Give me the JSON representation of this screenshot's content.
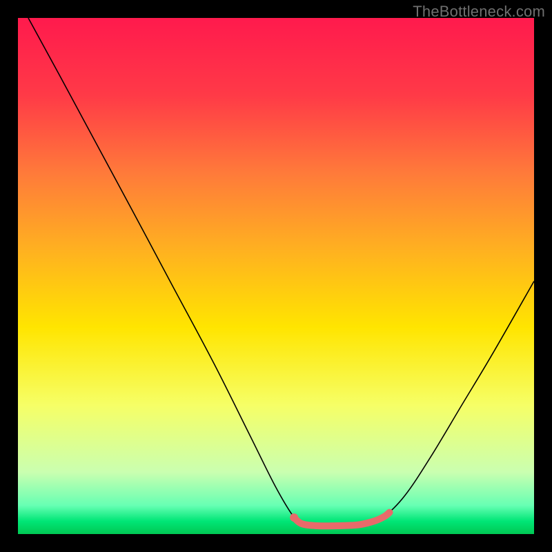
{
  "watermark": "TheBottleneck.com",
  "chart_data": {
    "type": "line",
    "title": "",
    "xlabel": "",
    "ylabel": "",
    "xlim": [
      0,
      100
    ],
    "ylim": [
      0,
      100
    ],
    "grid": false,
    "legend": false,
    "background_gradient": {
      "stops": [
        {
          "offset": 0.0,
          "color": "#ff1a4d"
        },
        {
          "offset": 0.15,
          "color": "#ff3a47"
        },
        {
          "offset": 0.3,
          "color": "#ff7a3a"
        },
        {
          "offset": 0.45,
          "color": "#ffb120"
        },
        {
          "offset": 0.6,
          "color": "#ffe500"
        },
        {
          "offset": 0.75,
          "color": "#f6ff66"
        },
        {
          "offset": 0.88,
          "color": "#caffb0"
        },
        {
          "offset": 0.945,
          "color": "#66ffb3"
        },
        {
          "offset": 0.975,
          "color": "#00e676"
        },
        {
          "offset": 1.0,
          "color": "#00c853"
        }
      ]
    },
    "series": [
      {
        "name": "bottleneck-curve",
        "color": "#000000",
        "width": 1.6,
        "points": [
          {
            "x": 2,
            "y": 100
          },
          {
            "x": 8,
            "y": 89
          },
          {
            "x": 15,
            "y": 76
          },
          {
            "x": 22,
            "y": 63
          },
          {
            "x": 30,
            "y": 48
          },
          {
            "x": 38,
            "y": 33
          },
          {
            "x": 45,
            "y": 19
          },
          {
            "x": 50,
            "y": 9
          },
          {
            "x": 53.5,
            "y": 3.2
          },
          {
            "x": 55,
            "y": 2
          },
          {
            "x": 58,
            "y": 1.6
          },
          {
            "x": 62,
            "y": 1.6
          },
          {
            "x": 66,
            "y": 1.8
          },
          {
            "x": 69,
            "y": 2.5
          },
          {
            "x": 71,
            "y": 3.4
          },
          {
            "x": 75,
            "y": 7.5
          },
          {
            "x": 80,
            "y": 15
          },
          {
            "x": 86,
            "y": 25
          },
          {
            "x": 92,
            "y": 35
          },
          {
            "x": 100,
            "y": 49
          }
        ]
      },
      {
        "name": "highlight-segment",
        "color": "#e86a6a",
        "width": 10,
        "cap": "round",
        "points": [
          {
            "x": 53.5,
            "y": 3.2
          },
          {
            "x": 55,
            "y": 2
          },
          {
            "x": 58,
            "y": 1.6
          },
          {
            "x": 62,
            "y": 1.6
          },
          {
            "x": 66,
            "y": 1.8
          },
          {
            "x": 69,
            "y": 2.5
          },
          {
            "x": 71,
            "y": 3.4
          },
          {
            "x": 72,
            "y": 4.2
          }
        ]
      },
      {
        "name": "highlight-dot",
        "color": "#e86a6a",
        "type": "scatter",
        "radius": 6,
        "points": [
          {
            "x": 53.5,
            "y": 3.2
          }
        ]
      }
    ]
  }
}
